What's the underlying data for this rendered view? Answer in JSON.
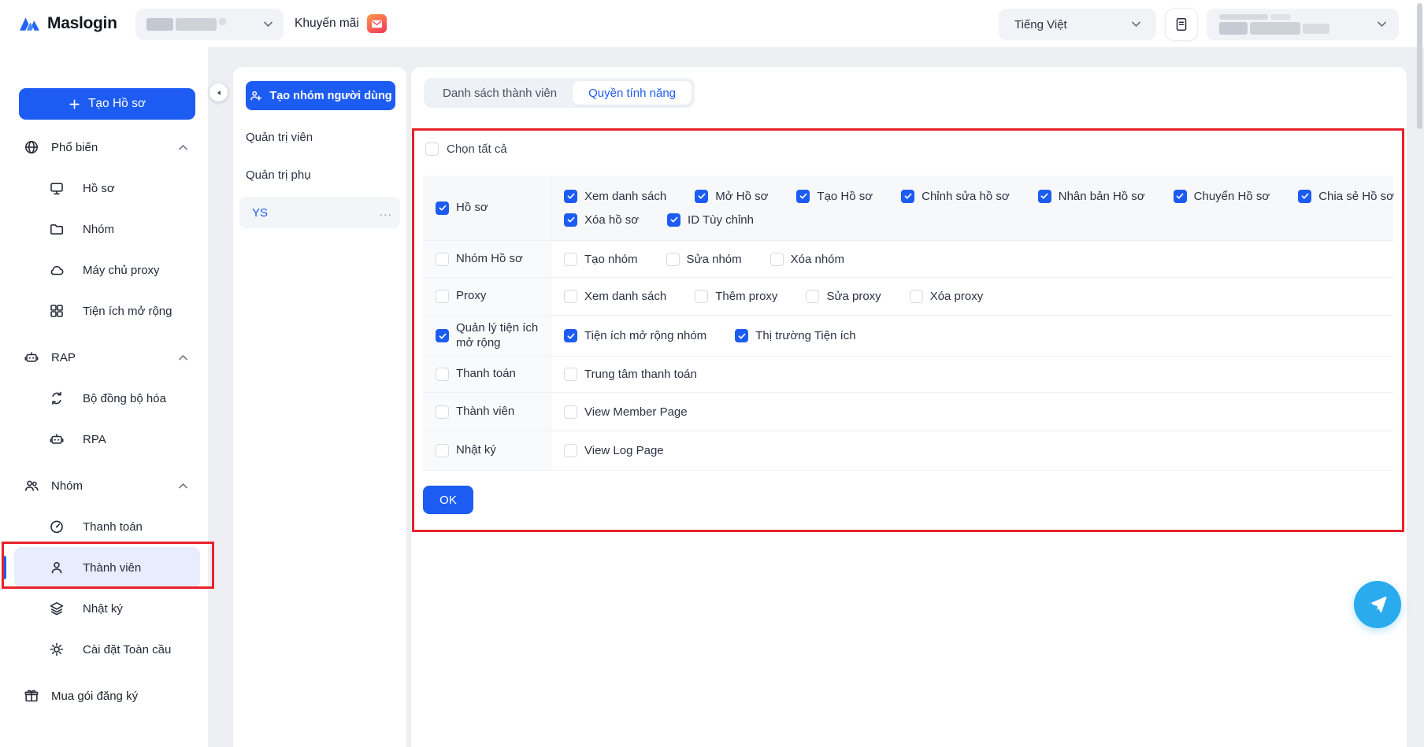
{
  "colors": {
    "primary": "#1d5cf2",
    "annotation_red": "#e8222a",
    "telegram_blue": "#2aabee",
    "promo_gradient_start": "#ff9a4d",
    "promo_gradient_end": "#f23557"
  },
  "header": {
    "brand": "Maslogin",
    "promo_label": "Khuyến mãi",
    "language_value": "Tiếng Việt"
  },
  "sidebar": {
    "create_button_label": "Tạo Hồ sơ",
    "sections": [
      {
        "label": "Phổ biến",
        "items": [
          {
            "label": "Hồ sơ"
          },
          {
            "label": "Nhóm"
          },
          {
            "label": "Máy chủ proxy"
          },
          {
            "label": "Tiện ích mở rộng"
          }
        ]
      },
      {
        "label": "RAP",
        "items": [
          {
            "label": "Bộ đồng bộ hóa"
          },
          {
            "label": "RPA"
          }
        ]
      },
      {
        "label": "Nhóm",
        "items": [
          {
            "label": "Thanh toán"
          },
          {
            "label": "Thành viên",
            "active": true
          },
          {
            "label": "Nhật ký"
          },
          {
            "label": "Cài đặt Toàn cầu"
          }
        ]
      }
    ],
    "footer_item": {
      "label": "Mua gói đăng ký"
    }
  },
  "groups_panel": {
    "create_group_button": "Tạo nhóm người dùng",
    "items": [
      {
        "label": "Quản trị viên"
      },
      {
        "label": "Quản trị phụ"
      },
      {
        "label": "YS",
        "selected": true,
        "menu": "..."
      }
    ]
  },
  "main": {
    "tabs": [
      {
        "label": "Danh sách thành viên"
      },
      {
        "label": "Quyền tính năng",
        "active": true
      }
    ],
    "select_all": {
      "label": "Chọn tất cả",
      "checked": false
    },
    "rows": [
      {
        "label": "Hồ sơ",
        "checked": true,
        "perms": [
          {
            "label": "Xem danh sách",
            "checked": true
          },
          {
            "label": "Mở Hồ sơ",
            "checked": true
          },
          {
            "label": "Tạo Hồ sơ",
            "checked": true
          },
          {
            "label": "Chỉnh sửa hồ sơ",
            "checked": true
          },
          {
            "label": "Nhân bản Hồ sơ",
            "checked": true
          },
          {
            "label": "Chuyển Hồ sơ",
            "checked": true
          },
          {
            "label": "Chia sẻ Hồ sơ",
            "checked": true
          },
          {
            "label": "Xóa hồ sơ",
            "checked": true
          },
          {
            "label": "ID Tùy chỉnh",
            "checked": true
          }
        ]
      },
      {
        "label": "Nhóm Hồ sơ",
        "checked": false,
        "perms": [
          {
            "label": "Tạo nhóm",
            "checked": false
          },
          {
            "label": "Sửa nhóm",
            "checked": false
          },
          {
            "label": "Xóa nhóm",
            "checked": false
          }
        ]
      },
      {
        "label": "Proxy",
        "checked": false,
        "perms": [
          {
            "label": "Xem danh sách",
            "checked": false
          },
          {
            "label": "Thêm proxy",
            "checked": false
          },
          {
            "label": "Sửa proxy",
            "checked": false
          },
          {
            "label": "Xóa proxy",
            "checked": false
          }
        ]
      },
      {
        "label": "Quản lý tiện ích mở rộng",
        "checked": true,
        "perms": [
          {
            "label": "Tiện ích mở rộng nhóm",
            "checked": true
          },
          {
            "label": "Thị trường Tiện ích",
            "checked": true
          }
        ]
      },
      {
        "label": "Thanh toán",
        "checked": false,
        "perms": [
          {
            "label": "Trung tâm thanh toán",
            "checked": false
          }
        ]
      },
      {
        "label": "Thành viên",
        "checked": false,
        "perms": [
          {
            "label": "View Member Page",
            "checked": false
          }
        ]
      },
      {
        "label": "Nhật ký",
        "checked": false,
        "perms": [
          {
            "label": "View Log Page",
            "checked": false
          }
        ]
      }
    ],
    "ok_button": "OK"
  }
}
